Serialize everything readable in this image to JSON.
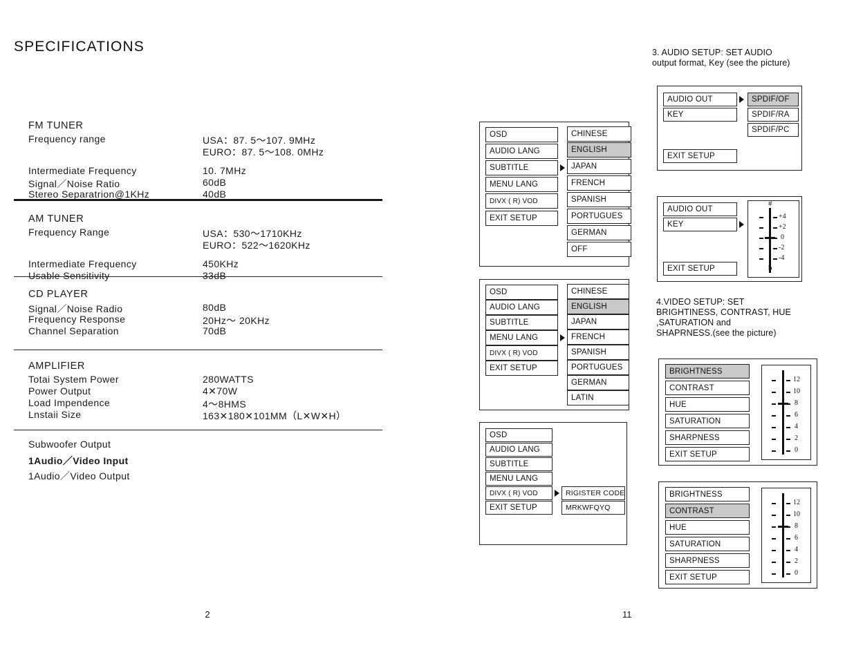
{
  "left_page": {
    "title": "SPECIFICATIONS",
    "page_number": "2",
    "sections": [
      {
        "heading": "FM TUNER",
        "rows": [
          {
            "label": "Frequency range",
            "value": "USA：87. 5～107. 9MHz",
            "value2": "EURO：87. 5～108. 0MHz"
          },
          {
            "label": "",
            "value": ""
          },
          {
            "label": "Intermediate Frequency",
            "value": "10. 7MHz"
          },
          {
            "label": "Signal／Noise Ratio",
            "value": "60dB"
          },
          {
            "label": "Stereo Separatrion@1KHz",
            "value": "40dB"
          }
        ]
      },
      {
        "heading": "AM TUNER",
        "rows": [
          {
            "label": "Frequency Range",
            "value": "USA：530～1710KHz",
            "value2": "EURO：522～1620KHz"
          },
          {
            "label": "",
            "value": ""
          },
          {
            "label": "Intermediate Frequency",
            "value": "450KHz"
          },
          {
            "label": "Usable Sensitivity",
            "value": "33dB"
          }
        ]
      },
      {
        "heading": "CD PLAYER",
        "rows": [
          {
            "label": "Signal／Noise Radio",
            "value": "80dB"
          },
          {
            "label": "Frequency Response",
            "value": "20Hz～ 20KHz"
          },
          {
            "label": "Channel Separation",
            "value": "70dB"
          }
        ]
      },
      {
        "heading": "AMPLIFIER",
        "rows": [
          {
            "label": "Totai System Power",
            "value": "280WATTS"
          },
          {
            "label": "Power Output",
            "value": "4✕70W"
          },
          {
            "label": "Load Impendence",
            "value": "4～8HMS"
          },
          {
            "label": "Lnstaii Size",
            "value": "163✕180✕101MM（L✕W✕H）"
          }
        ]
      }
    ],
    "io_lines": [
      {
        "text": "Subwoofer Output",
        "bold": false
      },
      {
        "text": "1Audio／Video Input",
        "bold": true
      },
      {
        "text": "1Audio／Video Output",
        "bold": false
      }
    ]
  },
  "right_page": {
    "page_number": "11",
    "audio_note": "3. AUDIO SETUP: SET AUDIO\noutput format, Key (see the picture)",
    "audio_note_line1": "3. AUDIO SETUP: SET AUDIO",
    "audio_note_line2": "output format, Key (see the picture)",
    "video_note_line1": "4.VIDEO SETUP: SET",
    "video_note_line2": "BRIGHTINESS, CONTRAST, HUE",
    "video_note_line3": ",SATURATION and",
    "video_note_line4": "SHAPRNESS.(see the picture)",
    "osd_menu_1": {
      "left_items": [
        {
          "label": "OSD",
          "selected": false
        },
        {
          "label": "AUDIO LANG",
          "selected": false
        },
        {
          "label": "SUBTITLE",
          "selected": false
        },
        {
          "label": "MENU LANG",
          "selected": false
        },
        {
          "label": "DIVX ( R) VOD",
          "selected": false
        },
        {
          "label": "EXIT SETUP",
          "selected": false
        }
      ],
      "arrow_on": "SUBTITLE",
      "right_items": [
        {
          "label": "CHINESE",
          "selected": false
        },
        {
          "label": "ENGLISH",
          "selected": true
        },
        {
          "label": "JAPAN",
          "selected": false
        },
        {
          "label": "FRENCH",
          "selected": false
        },
        {
          "label": "SPANISH",
          "selected": false
        },
        {
          "label": "PORTUGUES",
          "selected": false
        },
        {
          "label": "GERMAN",
          "selected": false
        },
        {
          "label": "OFF",
          "selected": false
        }
      ]
    },
    "osd_menu_2": {
      "left_items": [
        {
          "label": "OSD",
          "selected": false
        },
        {
          "label": "AUDIO LANG",
          "selected": false
        },
        {
          "label": "SUBTITLE",
          "selected": false
        },
        {
          "label": "MENU LANG",
          "selected": false
        },
        {
          "label": "DIVX ( R) VOD",
          "selected": false
        },
        {
          "label": "EXIT SETUP",
          "selected": false
        }
      ],
      "arrow_on": "MENU LANG",
      "right_items": [
        {
          "label": "CHINESE",
          "selected": false
        },
        {
          "label": "ENGLISH",
          "selected": true
        },
        {
          "label": "JAPAN",
          "selected": false
        },
        {
          "label": "FRENCH",
          "selected": false
        },
        {
          "label": "SPANISH",
          "selected": false
        },
        {
          "label": "PORTUGUES",
          "selected": false
        },
        {
          "label": "GERMAN",
          "selected": false
        },
        {
          "label": "LATIN",
          "selected": false
        }
      ]
    },
    "osd_menu_3": {
      "left_items": [
        {
          "label": "OSD",
          "selected": false
        },
        {
          "label": "AUDIO LANG",
          "selected": false
        },
        {
          "label": "SUBTITLE",
          "selected": false
        },
        {
          "label": "MENU LANG",
          "selected": false
        },
        {
          "label": "DIVX ( R) VOD",
          "selected": false
        },
        {
          "label": "EXIT SETUP",
          "selected": false
        }
      ],
      "arrow_on": "DIVX ( R) VOD",
      "right_items": [
        {
          "label": "RIGISTER CODE",
          "selected": false
        },
        {
          "label": "MRKWFQYQ",
          "selected": false
        }
      ]
    },
    "audio_out_menu": {
      "left_items": [
        {
          "label": "AUDIO OUT",
          "selected": false
        },
        {
          "label": "KEY",
          "selected": false
        },
        {
          "label": "EXIT SETUP",
          "selected": false
        }
      ],
      "arrow_on": "AUDIO OUT",
      "right_items": [
        {
          "label": "SPDIF/OF",
          "selected": true
        },
        {
          "label": "SPDIF/RA",
          "selected": false
        },
        {
          "label": "SPDIF/PC",
          "selected": false
        }
      ]
    },
    "key_menu": {
      "left_items": [
        {
          "label": "AUDIO OUT",
          "selected": false
        },
        {
          "label": "KEY",
          "selected": false
        },
        {
          "label": "EXIT SETUP",
          "selected": false
        }
      ],
      "arrow_on": "KEY",
      "slider": {
        "top_cap": "#",
        "bottom_cap": "b",
        "ticks": [
          "+4",
          "+2",
          "0",
          "-2",
          "-4"
        ],
        "current_value": "0"
      }
    },
    "brightness_menu": {
      "items": [
        {
          "label": "BRIGHTNESS",
          "selected": true
        },
        {
          "label": "CONTRAST",
          "selected": false
        },
        {
          "label": "HUE",
          "selected": false
        },
        {
          "label": "SATURATION",
          "selected": false
        },
        {
          "label": "SHARPNESS",
          "selected": false
        },
        {
          "label": "EXIT SETUP",
          "selected": false
        }
      ],
      "slider": {
        "ticks": [
          "12",
          "10",
          "8",
          "6",
          "4",
          "2",
          "0"
        ],
        "current_value": "8"
      }
    },
    "contrast_menu": {
      "items": [
        {
          "label": "BRIGHTNESS",
          "selected": false
        },
        {
          "label": "CONTRAST",
          "selected": true
        },
        {
          "label": "HUE",
          "selected": false
        },
        {
          "label": "SATURATION",
          "selected": false
        },
        {
          "label": "SHARPNESS",
          "selected": false
        },
        {
          "label": "EXIT SETUP",
          "selected": false
        }
      ],
      "slider": {
        "ticks": [
          "12",
          "10",
          "8",
          "6",
          "4",
          "2",
          "0"
        ],
        "current_value": "8"
      }
    }
  },
  "colors": {
    "ink": "#1a1a1a",
    "highlight": "#c9c9c9",
    "border": "#222222",
    "background": "#ffffff"
  }
}
